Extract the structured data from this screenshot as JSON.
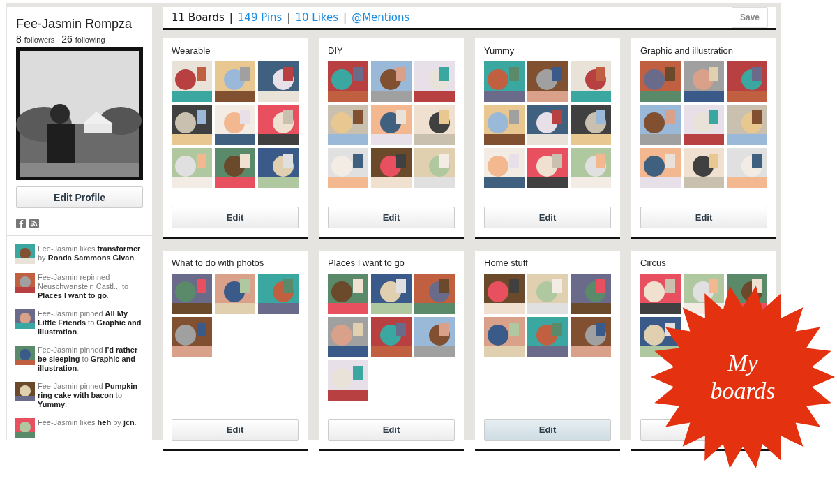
{
  "profile": {
    "name": "Fee-Jasmin Rompza",
    "followers_count": "8",
    "followers_label": "followers",
    "following_count": "26",
    "following_label": "following",
    "edit_button": "Edit Profile"
  },
  "activity": [
    {
      "text": "Fee-Jasmin likes **transformer** by **Ronda Sammons Givan**."
    },
    {
      "text": "Fee-Jasmin repinned Neuschwanstein Castl... to **Places I want to go**."
    },
    {
      "text": "Fee-Jasmin pinned **All My Little Friends** to **Graphic and illustration**."
    },
    {
      "text": "Fee-Jasmin pinned **I'd rather be sleeping** to **Graphic and illustration**."
    },
    {
      "text": "Fee-Jasmin pinned **Pumpkin ring cake with bacon** to **Yummy**."
    },
    {
      "text": "Fee-Jasmin likes **heh** by **jcn**."
    }
  ],
  "header": {
    "boards": "11 Boards",
    "separator": "|",
    "links": [
      "149 Pins",
      "10 Likes",
      "@Mentions"
    ],
    "save_button": "Save"
  },
  "boards": [
    {
      "title": "Wearable",
      "edit": "Edit",
      "hovered": false
    },
    {
      "title": "DIY",
      "edit": "Edit",
      "hovered": false
    },
    {
      "title": "Yummy",
      "edit": "Edit",
      "hovered": false
    },
    {
      "title": "Graphic and illustration",
      "edit": "Edit",
      "hovered": false
    },
    {
      "title": "What to do with photos",
      "edit": "Edit",
      "hovered": false
    },
    {
      "title": "Places I want to go",
      "edit": "Edit",
      "hovered": false
    },
    {
      "title": "Home stuff",
      "edit": "Edit",
      "hovered": true
    },
    {
      "title": "Circus",
      "hovered": false
    }
  ],
  "badge": {
    "text": "My boards"
  }
}
